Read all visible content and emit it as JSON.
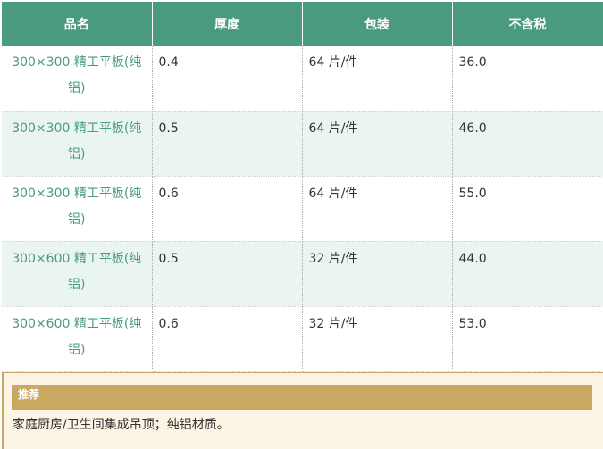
{
  "table": {
    "headers": [
      "品名",
      "厚度",
      "包装",
      "不含税"
    ],
    "rows": [
      {
        "name": "300×300 精工平板(纯铝)",
        "thickness": "0.4",
        "package": "64 片/件",
        "price": "36.0"
      },
      {
        "name": "300×300 精工平板(纯铝)",
        "thickness": "0.5",
        "package": "64 片/件",
        "price": "46.0"
      },
      {
        "name": "300×300 精工平板(纯铝)",
        "thickness": "0.6",
        "package": "64 片/件",
        "price": "55.0"
      },
      {
        "name": "300×600 精工平板(纯铝)",
        "thickness": "0.5",
        "package": "32 片/件",
        "price": "44.0"
      },
      {
        "name": "300×600 精工平板(纯铝)",
        "thickness": "0.6",
        "package": "32 片/件",
        "price": "53.0"
      }
    ]
  },
  "recommend": {
    "title": "推荐",
    "text": "家庭厨房/卫生间集成吊顶；纯铝材质。"
  },
  "colors": {
    "header_bg": "#4a9a7d",
    "name_text": "#4a9a7d",
    "alt_row_bg": "#ebf5ef",
    "recommend_accent": "#c9a861",
    "recommend_bg": "#fcf4e4"
  }
}
